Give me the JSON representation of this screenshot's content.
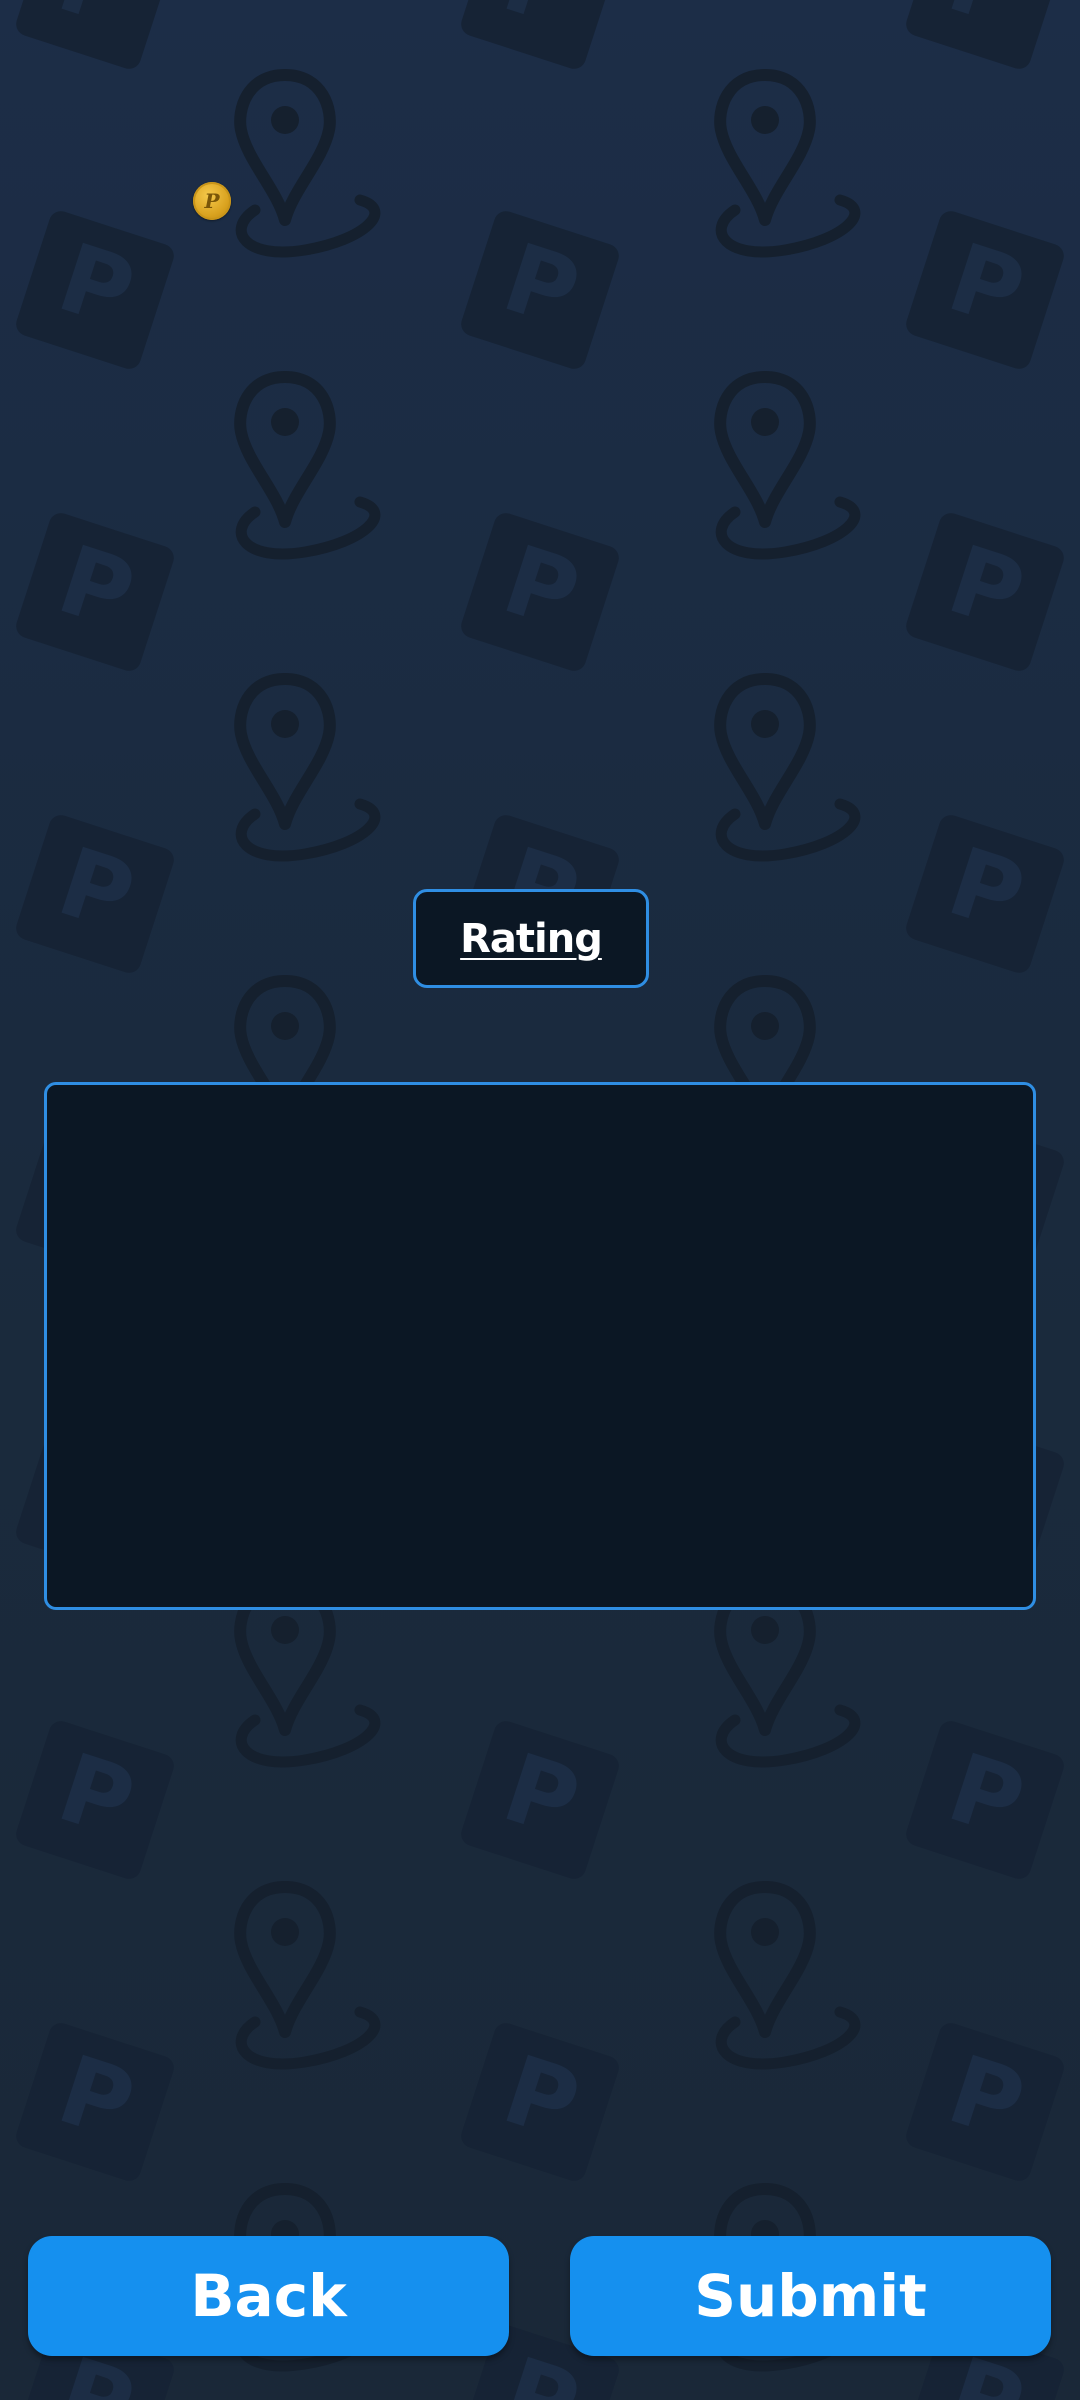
{
  "colors": {
    "background": "#1b2b40",
    "accent": "#2f8ee3",
    "button": "#1590ef",
    "panel": "#0b1724",
    "coin": "#d9a21f"
  },
  "coin": {
    "icon": "coin-icon",
    "symbol": "P"
  },
  "rating": {
    "label": "Rating"
  },
  "actions": {
    "back_label": "Back",
    "submit_label": "Submit"
  }
}
